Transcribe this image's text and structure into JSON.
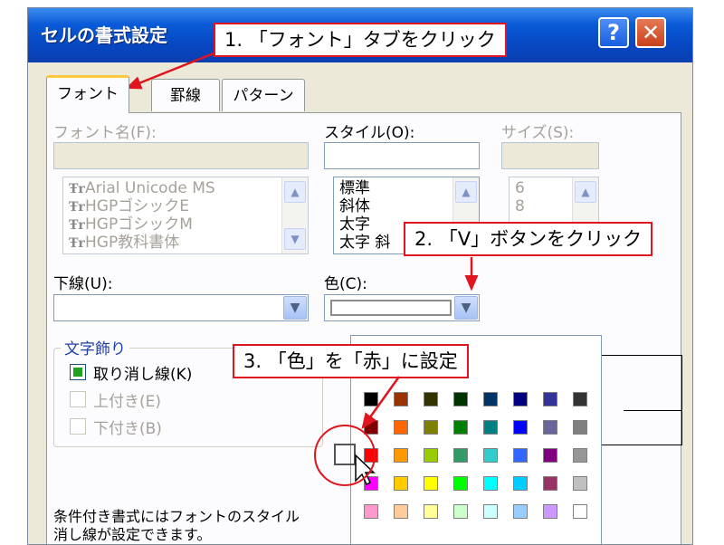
{
  "window": {
    "title": "セルの書式設定",
    "help_label": "?",
    "close_label": "✕"
  },
  "tabs": [
    {
      "label": "フォント"
    },
    {
      "label": "罫線"
    },
    {
      "label": "パターン"
    }
  ],
  "fields": {
    "font_name_label": "フォント名(F):",
    "style_label": "スタイル(O):",
    "size_label": "サイズ(S):",
    "underline_label": "下線(U):",
    "color_label": "色(C):"
  },
  "font_list": [
    {
      "name": "Arial Unicode MS",
      "icon": "truetype-icon",
      "glyph": "Ŧr"
    },
    {
      "name": "HGPゴシックE",
      "icon": "truetype-icon",
      "glyph": "Ŧr"
    },
    {
      "name": "HGPゴシックM",
      "icon": "truetype-icon",
      "glyph": "Ŧr"
    },
    {
      "name": "HGP教科書体",
      "icon": "truetype-icon",
      "glyph": "Ŧr"
    }
  ],
  "style_list": [
    "標準",
    "斜体",
    "太字",
    "太字 斜"
  ],
  "size_list": [
    "6",
    "8"
  ],
  "effects": {
    "legend": "文字飾り",
    "strikethrough": {
      "label": "取り消し線(K)",
      "checked": true
    },
    "superscript": {
      "label": "上付き(E)",
      "checked": false
    },
    "subscript": {
      "label": "下付き(B)",
      "checked": false
    }
  },
  "note": {
    "line1": "条件付き書式にはフォントのスタイル",
    "line2": "消し線が設定できます。"
  },
  "callouts": {
    "step1": "1. 「フォント」タブをクリック",
    "step2": "2. 「V」ボタンをクリック",
    "step3": "3. 「色」を「赤」に設定"
  },
  "palette": {
    "rows": [
      [
        "#000000",
        "#993300",
        "#333300",
        "#003300",
        "#003366",
        "#000080",
        "#333399",
        "#333333"
      ],
      [
        "#800000",
        "#FF6600",
        "#808000",
        "#008000",
        "#008080",
        "#0000FF",
        "#666699",
        "#808080"
      ],
      [
        "#FF0000",
        "#FF9900",
        "#99CC00",
        "#339966",
        "#33CCCC",
        "#3366FF",
        "#800080",
        "#969696"
      ],
      [
        "#FF00FF",
        "#FFCC00",
        "#FFFF00",
        "#00FF00",
        "#00FFFF",
        "#00CCFF",
        "#993366",
        "#C0C0C0"
      ],
      [
        "#FF99CC",
        "#FFCC99",
        "#FFFF99",
        "#CCFFCC",
        "#CCFFFF",
        "#99CCFF",
        "#CC99FF",
        "#FFFFFF"
      ]
    ],
    "selected": "#FF0000"
  },
  "colors": {
    "annotation": "#E0151F",
    "titlebar": "#0746C0",
    "tab_highlight": "#FFC83C"
  }
}
